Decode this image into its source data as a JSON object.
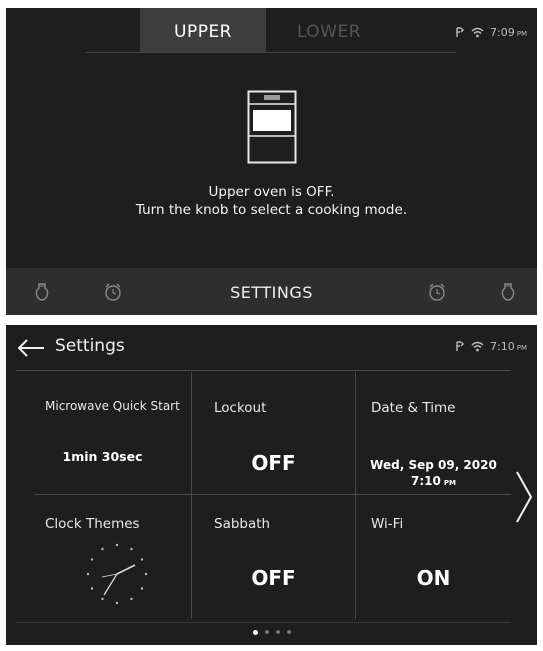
{
  "screen1": {
    "tabs": [
      {
        "label": "UPPER",
        "active": true
      },
      {
        "label": "LOWER",
        "active": false
      }
    ],
    "status": {
      "time": "7:09",
      "ampm": "PM"
    },
    "oven_icon": "oven-icon",
    "message_line1": "Upper oven is OFF.",
    "message_line2": "Turn the knob to select a cooking mode.",
    "bottom_bar": {
      "settings_label": "SETTINGS",
      "left_icons": [
        "light-bulb-icon",
        "timer-icon"
      ],
      "right_icons": [
        "timer-icon",
        "light-bulb-icon"
      ]
    }
  },
  "screen2": {
    "header": {
      "title": "Settings",
      "back_icon": "back-arrow-icon"
    },
    "status": {
      "time": "7:10",
      "ampm": "PM"
    },
    "tiles": [
      {
        "title": "Microwave Quick Start",
        "value": "1min 30sec"
      },
      {
        "title": "Lockout",
        "value": "OFF"
      },
      {
        "title": "Date & Time",
        "date": "Wed, Sep 09, 2020",
        "time": "7:10",
        "ampm": "PM"
      },
      {
        "title": "Clock Themes",
        "icon": "analog-clock-icon"
      },
      {
        "title": "Sabbath",
        "value": "OFF"
      },
      {
        "title": "Wi-Fi",
        "value": "ON"
      }
    ],
    "pagination": {
      "pages": 4,
      "current": 1
    },
    "next_icon": "chevron-right-icon"
  },
  "colors": {
    "screen_bg": "#1e1e1e",
    "active_tab": "#3d3d3d",
    "bottom_bar": "#2e2e2e",
    "divider": "#4a4a4a",
    "text": "#f2f2f2",
    "inactive_text": "#555555"
  }
}
